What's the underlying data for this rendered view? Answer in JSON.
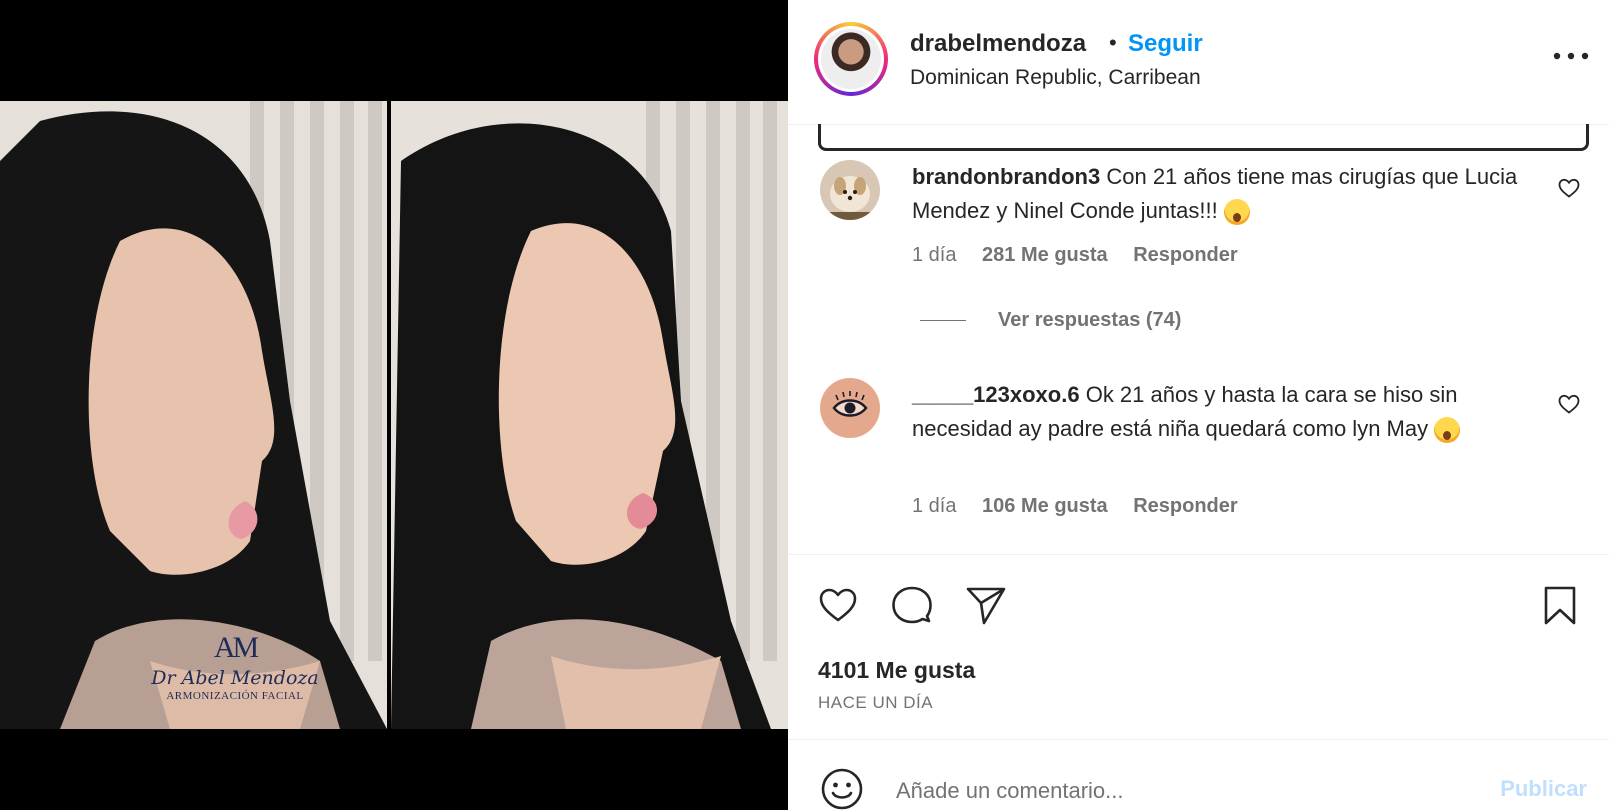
{
  "post": {
    "watermark": {
      "monogram": "AM",
      "name": "Dr Abel Mendoza",
      "subtitle": "ARMONIZACIÓN FACIAL"
    }
  },
  "header": {
    "username": "drabelmendoza",
    "separator": "•",
    "follow_label": "Seguir",
    "location": "Dominican Republic, Carribean",
    "more_icon": "more-horizontal-icon"
  },
  "comments": [
    {
      "username": "brandonbrandon3",
      "text": "Con 21 años tiene mas cirugías que Lucia Mendez y Ninel Conde juntas!!!",
      "emoji": "astonished-face-emoji",
      "time": "1 día",
      "likes": "281 Me gusta",
      "reply_label": "Responder",
      "view_replies": "Ver respuestas (74)"
    },
    {
      "username": "_____123xoxo.6",
      "text": "Ok 21 años y hasta la cara se hiso sin necesidad ay padre está niña quedará como lyn May",
      "emoji": "screaming-face-emoji",
      "time": "1 día",
      "likes": "106 Me gusta",
      "reply_label": "Responder"
    }
  ],
  "stats": {
    "likes": "4101 Me gusta",
    "posted": "HACE UN DÍA"
  },
  "composer": {
    "placeholder": "Añade un comentario...",
    "publish_label": "Publicar"
  },
  "colors": {
    "link": "#0095f6",
    "muted": "#737373",
    "publish_disabled": "#c0dffd"
  }
}
